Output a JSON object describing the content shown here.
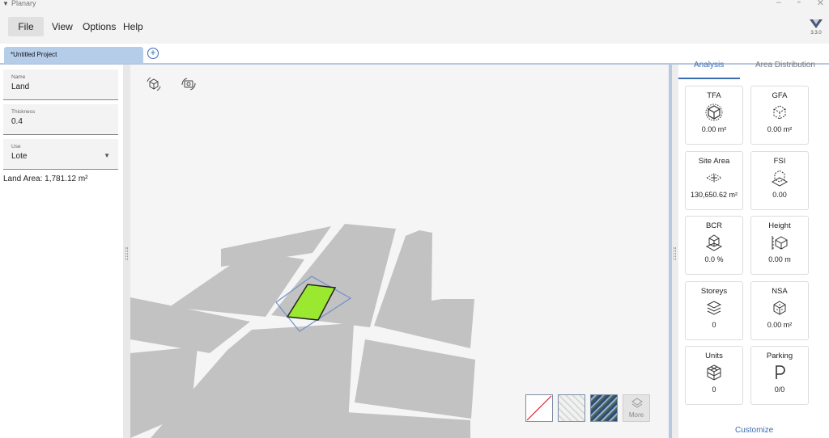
{
  "app": {
    "title": "Planary",
    "version": "3.3.0"
  },
  "menu": {
    "items": [
      "File",
      "View",
      "Options",
      "Help"
    ]
  },
  "tabs": {
    "active": "*Untitled Project"
  },
  "left_panel": {
    "name_label": "Name",
    "name_value": "Land",
    "thickness_label": "Thickness",
    "thickness_value": "0.4",
    "use_label": "Use",
    "use_value": "Lote",
    "land_area": "Land Area: 1,781.12 m²"
  },
  "viewport": {
    "basemaps": {
      "more_label": "More"
    }
  },
  "right_panel": {
    "tabs": [
      "Analysis",
      "Area Distribution"
    ],
    "cards": [
      {
        "title": "TFA",
        "value": "0.00 m²",
        "icon": "tfa-cube-icon"
      },
      {
        "title": "GFA",
        "value": "0.00 m²",
        "icon": "gfa-cube-icon"
      },
      {
        "title": "Site Area",
        "value": "130,650.62 m²",
        "icon": "site-area-icon"
      },
      {
        "title": "FSI",
        "value": "0.00",
        "icon": "fsi-icon"
      },
      {
        "title": "BCR",
        "value": "0.0 %",
        "icon": "bcr-icon"
      },
      {
        "title": "Height",
        "value": "0.00 m",
        "icon": "height-icon"
      },
      {
        "title": "Storeys",
        "value": "0",
        "icon": "storeys-layers-icon"
      },
      {
        "title": "NSA",
        "value": "0.00 m²",
        "icon": "nsa-cube-icon"
      },
      {
        "title": "Units",
        "value": "0",
        "icon": "units-cubes-icon"
      },
      {
        "title": "Parking",
        "value": "0/0",
        "icon": "parking-icon"
      }
    ],
    "customize_label": "Customize"
  }
}
